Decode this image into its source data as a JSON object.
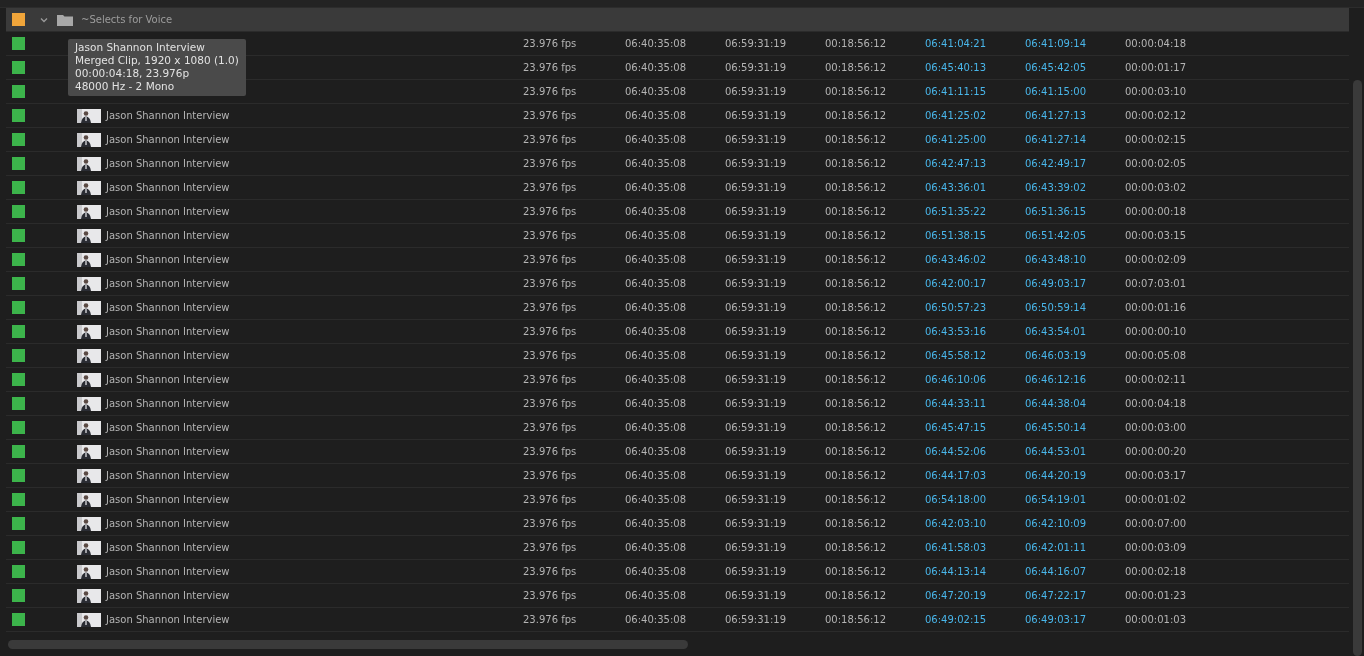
{
  "folder": {
    "name": "~Selects for Voice",
    "expanded": true,
    "selected": true,
    "color": "#f0a53a"
  },
  "tooltip": {
    "lines": [
      "Jason Shannon Interview",
      "Merged Clip, 1920 x 1080 (1.0)",
      "00:00:04:18, 23.976p",
      "48000 Hz - 2 Mono"
    ]
  },
  "rows": [
    {
      "name": null,
      "frame_rate": "23.976 fps",
      "media_start": "06:40:35:08",
      "media_end": "06:59:31:19",
      "media_duration": "00:18:56:12",
      "in_point": "06:41:04:21",
      "out_point": "06:41:09:14",
      "duration": "00:00:04:18",
      "color": "#3cb44b",
      "selected": false
    },
    {
      "name": null,
      "frame_rate": "23.976 fps",
      "media_start": "06:40:35:08",
      "media_end": "06:59:31:19",
      "media_duration": "00:18:56:12",
      "in_point": "06:45:40:13",
      "out_point": "06:45:42:05",
      "duration": "00:00:01:17",
      "color": "#3cb44b",
      "selected": false
    },
    {
      "name": null,
      "frame_rate": "23.976 fps",
      "media_start": "06:40:35:08",
      "media_end": "06:59:31:19",
      "media_duration": "00:18:56:12",
      "in_point": "06:41:11:15",
      "out_point": "06:41:15:00",
      "duration": "00:00:03:10",
      "color": "#3cb44b",
      "selected": false
    },
    {
      "name": "Jason Shannon Interview",
      "frame_rate": "23.976 fps",
      "media_start": "06:40:35:08",
      "media_end": "06:59:31:19",
      "media_duration": "00:18:56:12",
      "in_point": "06:41:25:02",
      "out_point": "06:41:27:13",
      "duration": "00:00:02:12",
      "color": "#3cb44b",
      "selected": false
    },
    {
      "name": "Jason Shannon Interview",
      "frame_rate": "23.976 fps",
      "media_start": "06:40:35:08",
      "media_end": "06:59:31:19",
      "media_duration": "00:18:56:12",
      "in_point": "06:41:25:00",
      "out_point": "06:41:27:14",
      "duration": "00:00:02:15",
      "color": "#3cb44b",
      "selected": false
    },
    {
      "name": "Jason Shannon Interview",
      "frame_rate": "23.976 fps",
      "media_start": "06:40:35:08",
      "media_end": "06:59:31:19",
      "media_duration": "00:18:56:12",
      "in_point": "06:42:47:13",
      "out_point": "06:42:49:17",
      "duration": "00:00:02:05",
      "color": "#3cb44b",
      "selected": false
    },
    {
      "name": "Jason Shannon Interview",
      "frame_rate": "23.976 fps",
      "media_start": "06:40:35:08",
      "media_end": "06:59:31:19",
      "media_duration": "00:18:56:12",
      "in_point": "06:43:36:01",
      "out_point": "06:43:39:02",
      "duration": "00:00:03:02",
      "color": "#3cb44b",
      "selected": false
    },
    {
      "name": "Jason Shannon Interview",
      "frame_rate": "23.976 fps",
      "media_start": "06:40:35:08",
      "media_end": "06:59:31:19",
      "media_duration": "00:18:56:12",
      "in_point": "06:51:35:22",
      "out_point": "06:51:36:15",
      "duration": "00:00:00:18",
      "color": "#3cb44b",
      "selected": false
    },
    {
      "name": "Jason Shannon Interview",
      "frame_rate": "23.976 fps",
      "media_start": "06:40:35:08",
      "media_end": "06:59:31:19",
      "media_duration": "00:18:56:12",
      "in_point": "06:51:38:15",
      "out_point": "06:51:42:05",
      "duration": "00:00:03:15",
      "color": "#3cb44b",
      "selected": false
    },
    {
      "name": "Jason Shannon Interview",
      "frame_rate": "23.976 fps",
      "media_start": "06:40:35:08",
      "media_end": "06:59:31:19",
      "media_duration": "00:18:56:12",
      "in_point": "06:43:46:02",
      "out_point": "06:43:48:10",
      "duration": "00:00:02:09",
      "color": "#3cb44b",
      "selected": false
    },
    {
      "name": "Jason Shannon Interview",
      "frame_rate": "23.976 fps",
      "media_start": "06:40:35:08",
      "media_end": "06:59:31:19",
      "media_duration": "00:18:56:12",
      "in_point": "06:42:00:17",
      "out_point": "06:49:03:17",
      "duration": "00:07:03:01",
      "color": "#3cb44b",
      "selected": false
    },
    {
      "name": "Jason Shannon Interview",
      "frame_rate": "23.976 fps",
      "media_start": "06:40:35:08",
      "media_end": "06:59:31:19",
      "media_duration": "00:18:56:12",
      "in_point": "06:50:57:23",
      "out_point": "06:50:59:14",
      "duration": "00:00:01:16",
      "color": "#3cb44b",
      "selected": false
    },
    {
      "name": "Jason Shannon Interview",
      "frame_rate": "23.976 fps",
      "media_start": "06:40:35:08",
      "media_end": "06:59:31:19",
      "media_duration": "00:18:56:12",
      "in_point": "06:43:53:16",
      "out_point": "06:43:54:01",
      "duration": "00:00:00:10",
      "color": "#3cb44b",
      "selected": false
    },
    {
      "name": "Jason Shannon Interview",
      "frame_rate": "23.976 fps",
      "media_start": "06:40:35:08",
      "media_end": "06:59:31:19",
      "media_duration": "00:18:56:12",
      "in_point": "06:45:58:12",
      "out_point": "06:46:03:19",
      "duration": "00:00:05:08",
      "color": "#3cb44b",
      "selected": false
    },
    {
      "name": "Jason Shannon Interview",
      "frame_rate": "23.976 fps",
      "media_start": "06:40:35:08",
      "media_end": "06:59:31:19",
      "media_duration": "00:18:56:12",
      "in_point": "06:46:10:06",
      "out_point": "06:46:12:16",
      "duration": "00:00:02:11",
      "color": "#3cb44b",
      "selected": false
    },
    {
      "name": "Jason Shannon Interview",
      "frame_rate": "23.976 fps",
      "media_start": "06:40:35:08",
      "media_end": "06:59:31:19",
      "media_duration": "00:18:56:12",
      "in_point": "06:44:33:11",
      "out_point": "06:44:38:04",
      "duration": "00:00:04:18",
      "color": "#3cb44b",
      "selected": false
    },
    {
      "name": "Jason Shannon Interview",
      "frame_rate": "23.976 fps",
      "media_start": "06:40:35:08",
      "media_end": "06:59:31:19",
      "media_duration": "00:18:56:12",
      "in_point": "06:45:47:15",
      "out_point": "06:45:50:14",
      "duration": "00:00:03:00",
      "color": "#3cb44b",
      "selected": false
    },
    {
      "name": "Jason Shannon Interview",
      "frame_rate": "23.976 fps",
      "media_start": "06:40:35:08",
      "media_end": "06:59:31:19",
      "media_duration": "00:18:56:12",
      "in_point": "06:44:52:06",
      "out_point": "06:44:53:01",
      "duration": "00:00:00:20",
      "color": "#3cb44b",
      "selected": false
    },
    {
      "name": "Jason Shannon Interview",
      "frame_rate": "23.976 fps",
      "media_start": "06:40:35:08",
      "media_end": "06:59:31:19",
      "media_duration": "00:18:56:12",
      "in_point": "06:44:17:03",
      "out_point": "06:44:20:19",
      "duration": "00:00:03:17",
      "color": "#3cb44b",
      "selected": false
    },
    {
      "name": "Jason Shannon Interview",
      "frame_rate": "23.976 fps",
      "media_start": "06:40:35:08",
      "media_end": "06:59:31:19",
      "media_duration": "00:18:56:12",
      "in_point": "06:54:18:00",
      "out_point": "06:54:19:01",
      "duration": "00:00:01:02",
      "color": "#3cb44b",
      "selected": false
    },
    {
      "name": "Jason Shannon Interview",
      "frame_rate": "23.976 fps",
      "media_start": "06:40:35:08",
      "media_end": "06:59:31:19",
      "media_duration": "00:18:56:12",
      "in_point": "06:42:03:10",
      "out_point": "06:42:10:09",
      "duration": "00:00:07:00",
      "color": "#3cb44b",
      "selected": false
    },
    {
      "name": "Jason Shannon Interview",
      "frame_rate": "23.976 fps",
      "media_start": "06:40:35:08",
      "media_end": "06:59:31:19",
      "media_duration": "00:18:56:12",
      "in_point": "06:41:58:03",
      "out_point": "06:42:01:11",
      "duration": "00:00:03:09",
      "color": "#3cb44b",
      "selected": false
    },
    {
      "name": "Jason Shannon Interview",
      "frame_rate": "23.976 fps",
      "media_start": "06:40:35:08",
      "media_end": "06:59:31:19",
      "media_duration": "00:18:56:12",
      "in_point": "06:44:13:14",
      "out_point": "06:44:16:07",
      "duration": "00:00:02:18",
      "color": "#3cb44b",
      "selected": false
    },
    {
      "name": "Jason Shannon Interview",
      "frame_rate": "23.976 fps",
      "media_start": "06:40:35:08",
      "media_end": "06:59:31:19",
      "media_duration": "00:18:56:12",
      "in_point": "06:47:20:19",
      "out_point": "06:47:22:17",
      "duration": "00:00:01:23",
      "color": "#3cb44b",
      "selected": false
    },
    {
      "name": "Jason Shannon Interview",
      "frame_rate": "23.976 fps",
      "media_start": "06:40:35:08",
      "media_end": "06:59:31:19",
      "media_duration": "00:18:56:12",
      "in_point": "06:49:02:15",
      "out_point": "06:49:03:17",
      "duration": "00:00:01:03",
      "color": "#3cb44b",
      "selected": false
    }
  ]
}
